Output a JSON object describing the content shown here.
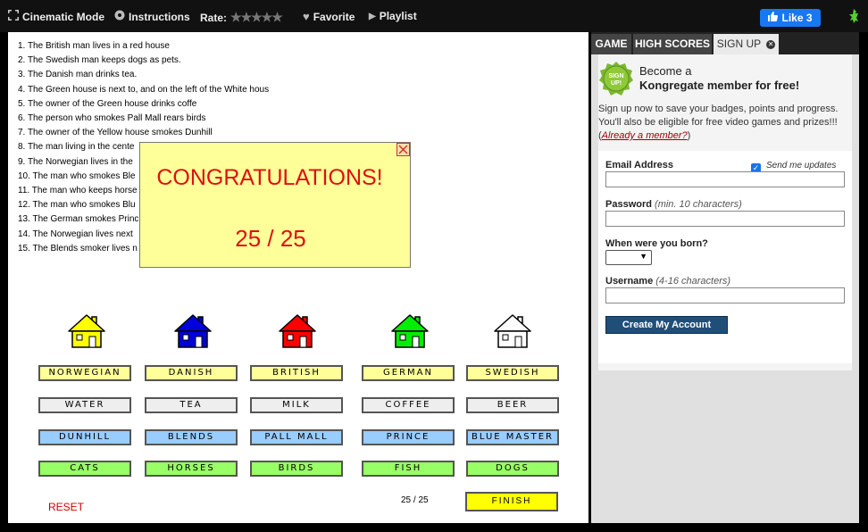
{
  "topbar": {
    "cinematic_label": "Cinematic Mode",
    "instructions_label": "Instructions",
    "rate_label": "Rate:",
    "rating_stars": "★★★★★",
    "favorite_label": "Favorite",
    "playlist_label": "Playlist",
    "like_label": "Like 3"
  },
  "game": {
    "clues": [
      "1. The British man lives in a red house",
      "2. The Swedish man keeps dogs as pets.",
      "3. The Danish man drinks tea.",
      "4. The Green house is next to, and on the left of the White hous",
      "5. The owner of the Green house drinks coffe",
      "6. The person who smokes Pall Mall rears birds",
      "7. The owner of the Yellow house smokes Dunhill",
      "8. The man living in the cente",
      "9. The Norwegian lives in the",
      "10. The man who smokes Ble",
      "11. The man who keeps horse",
      "12. The man who smokes Blu",
      "13. The German smokes Prinс",
      "14. The Norwegian lives next",
      "15. The Blends smoker lives n"
    ],
    "house_colors": [
      "#ffff00",
      "#0000dd",
      "#ff0000",
      "#00ee00",
      "#ffffff"
    ],
    "nationalities": [
      "NORWEGIAN",
      "DANISH",
      "BRITISH",
      "GERMAN",
      "SWEDISH"
    ],
    "drinks": [
      "WATER",
      "TEA",
      "MILK",
      "COFFEE",
      "BEER"
    ],
    "smokes": [
      "DUNHILL",
      "BLENDS",
      "PALL MALL",
      "PRINCE",
      "BLUE MASTER"
    ],
    "pets": [
      "CATS",
      "HORSES",
      "BIRDS",
      "FISH",
      "DOGS"
    ],
    "reset_label": "RESET",
    "score_small": "25 / 25",
    "finish_label": "FINISH",
    "popup": {
      "title": "CONGRATULATIONS!",
      "score": "25 / 25"
    }
  },
  "side": {
    "tabs": [
      "GAME",
      "HIGH SCORES",
      "SIGN UP"
    ],
    "badge_text": "SIGN UP!",
    "become_line1": "Become a",
    "become_line2": "Kongregate member for free!",
    "intro_text": "Sign up now to save your badges, points and progress. You'll also be eligible for free video games and prizes!!! (",
    "already_member": "Already a member?",
    "intro_close": ")",
    "email_label": "Email Address",
    "send_updates": "Send me updates",
    "password_label": "Password",
    "password_hint": "(min. 10 characters)",
    "born_label": "When were you born?",
    "username_label": "Username",
    "username_hint": "(4-16 characters)",
    "create_label": "Create My Account"
  }
}
